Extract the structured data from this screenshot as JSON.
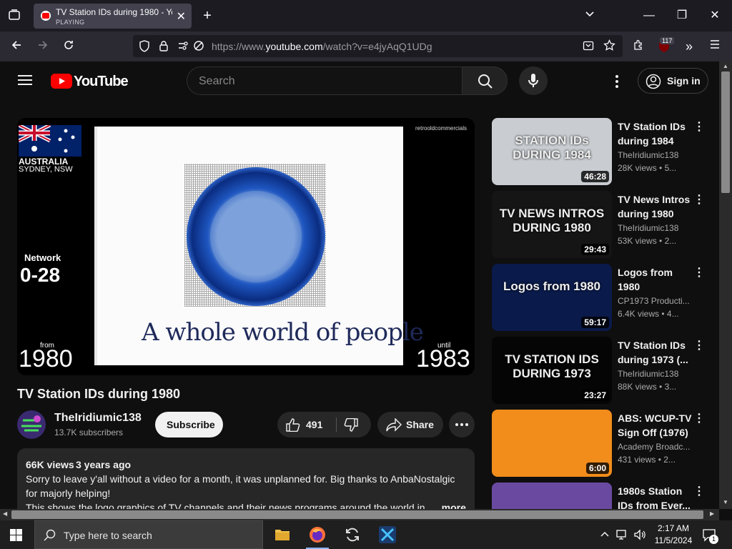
{
  "browser": {
    "tab": {
      "title": "TV Station IDs during 1980 - You",
      "status": "PLAYING"
    },
    "url_prefix": "https://www.",
    "url_domain": "youtube.com",
    "url_path": "/watch?v=e4jyAqQ1UDg",
    "extensions_badge": "117"
  },
  "youtube": {
    "logo_text": "YouTube",
    "search_placeholder": "Search",
    "sign_in_label": "Sign in",
    "video": {
      "title": "TV Station IDs during 1980",
      "overlay": {
        "country": "AUSTRALIA",
        "city": "SYDNEY, NSW",
        "watermark": "retrooldcommercials",
        "network_label": "Network",
        "network_value": "0-28",
        "from_label": "from",
        "from_year": "1980",
        "until_label": "until",
        "until_year": "1983",
        "slogan": "A whole world of people"
      }
    },
    "channel": {
      "name": "TheIridiumic138",
      "subscribers": "13.7K subscribers"
    },
    "subscribe_label": "Subscribe",
    "likes": "491",
    "share_label": "Share",
    "description": {
      "views": "66K views",
      "age": "3 years ago",
      "line1": "Sorry to leave y'all without a video for a month, it was unplanned for. Big thanks to AnbaNostalgic",
      "line2": "for majorly helping!",
      "line3": "This shows the logo graphics of TV channels and their news programs around the world in",
      "more_label": "...more"
    },
    "recommendations": [
      {
        "title_l1": "TV Station IDs",
        "title_l2": "during 1984",
        "channel": "TheIridiumic138",
        "views": "28K views",
        "age": "5...",
        "duration": "46:28",
        "thumb_text": "STATION IDs DURING 1984",
        "thumb_bg": "#c9cdd2"
      },
      {
        "title_l1": "TV News Intros",
        "title_l2": "during 1980",
        "channel": "TheIridiumic138",
        "views": "53K views",
        "age": "2...",
        "duration": "29:43",
        "thumb_text": "TV NEWS INTROS DURING 1980",
        "thumb_bg": "#151515"
      },
      {
        "title_l1": "Logos from",
        "title_l2": "1980",
        "channel": "CP1973 Producti...",
        "views": "6.4K views",
        "age": "4...",
        "duration": "59:17",
        "thumb_text": "Logos from 1980",
        "thumb_bg": "#0a1a4a"
      },
      {
        "title_l1": "TV Station IDs",
        "title_l2": "during 1973 (...",
        "channel": "TheIridiumic138",
        "views": "88K views",
        "age": "3...",
        "duration": "23:27",
        "thumb_text": "TV STATION IDS DURING 1973",
        "thumb_bg": "#050505"
      },
      {
        "title_l1": "ABS: WCUP-TV",
        "title_l2": "Sign Off (1976)",
        "channel": "Academy Broadc...",
        "views": "431 views",
        "age": "2...",
        "duration": "6:00",
        "thumb_text": "",
        "thumb_bg": "#f28c1a"
      },
      {
        "title_l1": "1980s Station",
        "title_l2": "IDs from Ever...",
        "channel": "",
        "views": "",
        "age": "",
        "duration": "",
        "thumb_text": "",
        "thumb_bg": "#6a4aa0"
      }
    ]
  },
  "taskbar": {
    "search_placeholder": "Type here to search",
    "time": "2:17 AM",
    "date": "11/5/2024",
    "notification_count": "1"
  }
}
